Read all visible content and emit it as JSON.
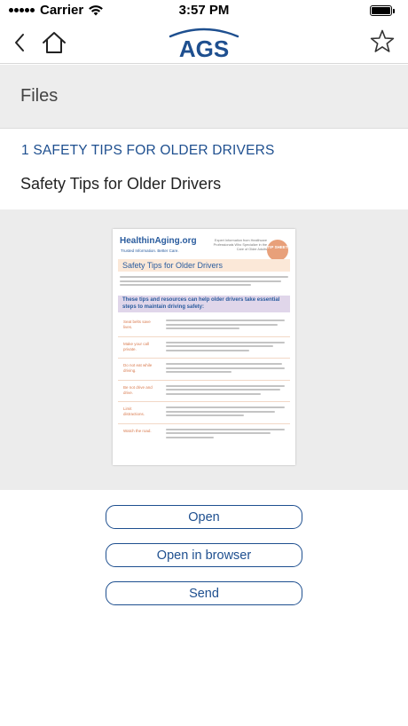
{
  "status_bar": {
    "carrier": "Carrier",
    "time": "3:57 PM"
  },
  "nav_bar": {
    "logo_text": "AGS",
    "brand_color": "#1e4f8f"
  },
  "section": {
    "title": "Files"
  },
  "document": {
    "category": "1 SAFETY TIPS FOR OLDER DRIVERS",
    "title": "Safety Tips for Older Drivers"
  },
  "preview": {
    "brand": "HealthinAging.org",
    "tagline": "Trusted Information. Better Care.",
    "header_note": "Expert Information from Healthcare Professionals Who Specialize in the Care of Older Adults",
    "badge": "TIP SHEET",
    "title": "Safety Tips for Older Drivers",
    "lead": "These tips and resources can help older drivers take essential steps to maintain driving safety:",
    "rows": [
      {
        "label": "Seat belts save lives."
      },
      {
        "label": "Make your call private."
      },
      {
        "label": "Do not eat while driving."
      },
      {
        "label": "Be not drive and drive."
      },
      {
        "label": "Limit distractions."
      },
      {
        "label": "Watch the road."
      }
    ]
  },
  "actions": {
    "open": "Open",
    "open_in_browser": "Open in browser",
    "send": "Send"
  },
  "icons": {
    "back": "chevron-left-icon",
    "home": "home-icon",
    "favorite": "star-outline-icon",
    "wifi": "wifi-icon",
    "battery": "battery-icon"
  }
}
